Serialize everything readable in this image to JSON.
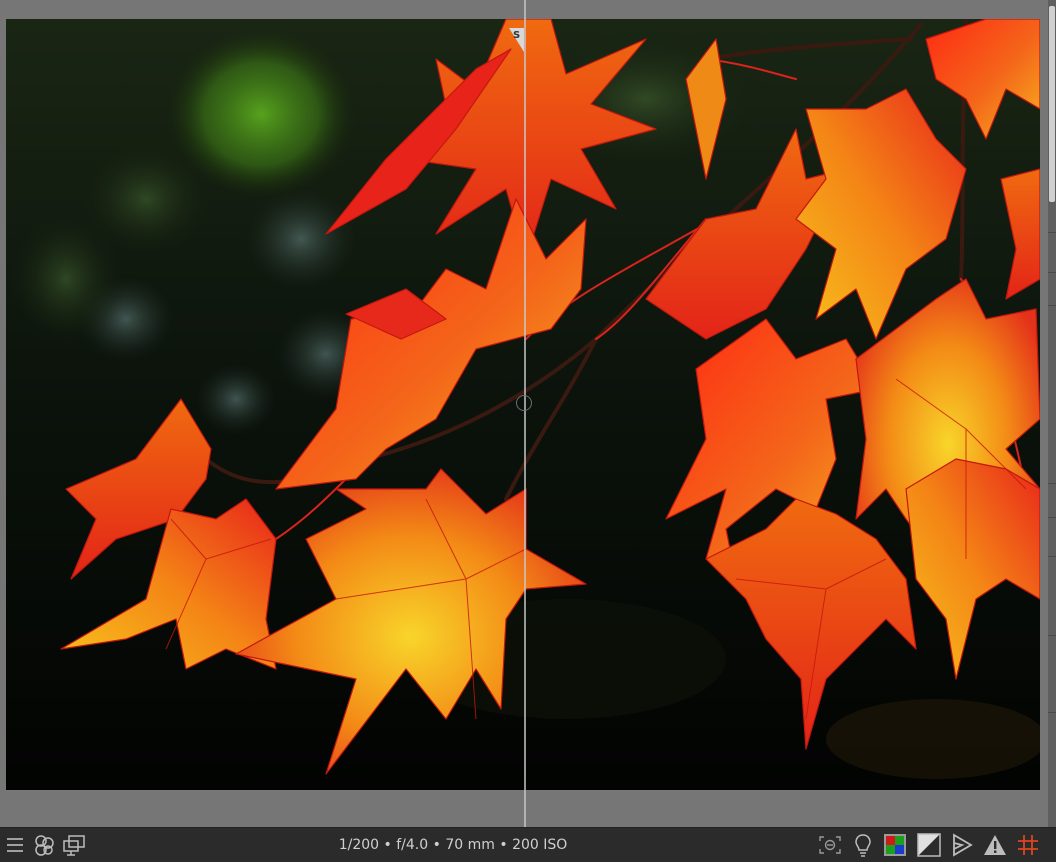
{
  "view": {
    "split_marker_letter": "S"
  },
  "bottom_bar": {
    "exif": {
      "exposure": "1/200",
      "aperture": "f/4.0",
      "focal_length": "70 mm",
      "iso": "200 ISO",
      "separator": " • "
    },
    "left_icons": [
      "panel-toggle-icon",
      "color-wheel-icon",
      "display-monitor-icon"
    ],
    "right_icons": [
      "focus-peaking-icon",
      "bulb-icon",
      "color-assessment-icon",
      "clipping-indicator-icon",
      "softproof-icon",
      "gamut-warning-icon",
      "guides-grid-icon"
    ]
  },
  "colors": {
    "background": "#767676",
    "bottom_bar": "#2b2b2b",
    "leaf_red": "#e8201a",
    "leaf_orange": "#f07a10",
    "leaf_yellow": "#f5c21a",
    "grid_icon": "#e0451f"
  }
}
